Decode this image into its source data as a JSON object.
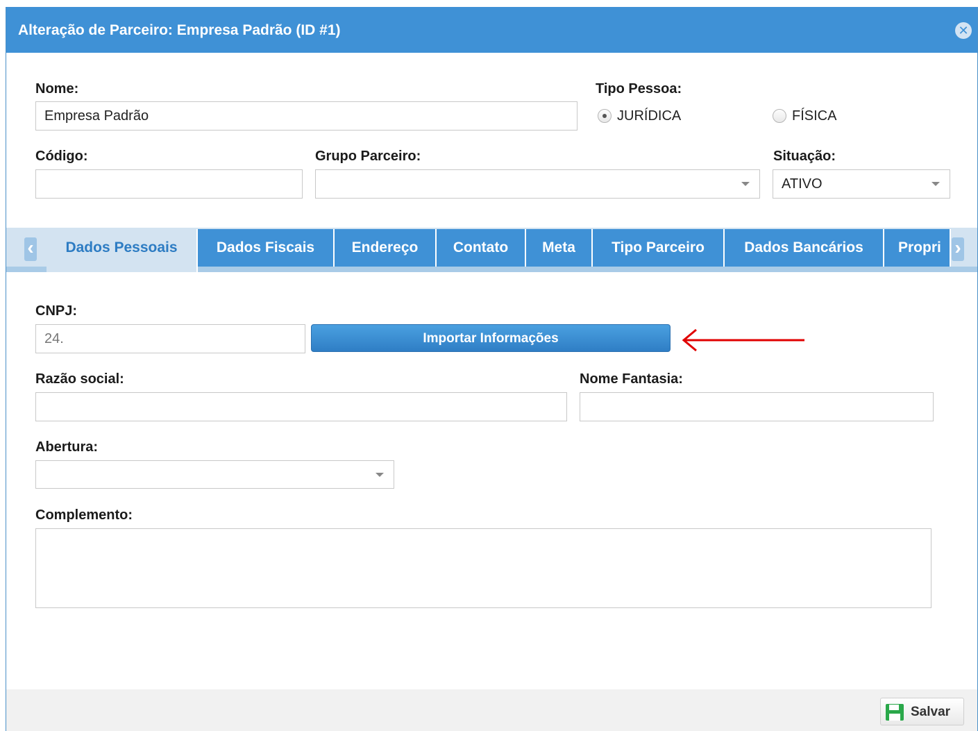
{
  "dialog": {
    "title": "Alteração de Parceiro: Empresa Padrão (ID #1)",
    "close_label": "✕"
  },
  "form": {
    "nome": {
      "label": "Nome:",
      "value": "Empresa Padrão"
    },
    "tipo_pessoa": {
      "label": "Tipo Pessoa:",
      "options": [
        "JURÍDICA",
        "FÍSICA"
      ],
      "selected": "JURÍDICA"
    },
    "codigo": {
      "label": "Código:",
      "value": ""
    },
    "grupo_parceiro": {
      "label": "Grupo Parceiro:",
      "value": ""
    },
    "situacao": {
      "label": "Situação:",
      "value": "ATIVO"
    }
  },
  "tabs": {
    "prev_icon": "‹",
    "next_icon": "›",
    "items": [
      {
        "label": "Dados Pessoais",
        "active": true
      },
      {
        "label": "Dados Fiscais"
      },
      {
        "label": "Endereço"
      },
      {
        "label": "Contato"
      },
      {
        "label": "Meta"
      },
      {
        "label": "Tipo Parceiro"
      },
      {
        "label": "Dados Bancários"
      },
      {
        "label": "Propri"
      }
    ]
  },
  "dados_pessoais": {
    "cnpj": {
      "label": "CNPJ:",
      "value": "24."
    },
    "import_button": "Importar Informações",
    "razao_social": {
      "label": "Razão social:",
      "value": ""
    },
    "nome_fantasia": {
      "label": "Nome Fantasia:",
      "value": ""
    },
    "abertura": {
      "label": "Abertura:",
      "value": ""
    },
    "complemento": {
      "label": "Complemento:",
      "value": ""
    }
  },
  "footer": {
    "save_label": "Salvar"
  },
  "colors": {
    "header_blue": "#3f91d6",
    "annotation_arrow": "#e00000",
    "save_icon_green": "#2aa84a"
  }
}
